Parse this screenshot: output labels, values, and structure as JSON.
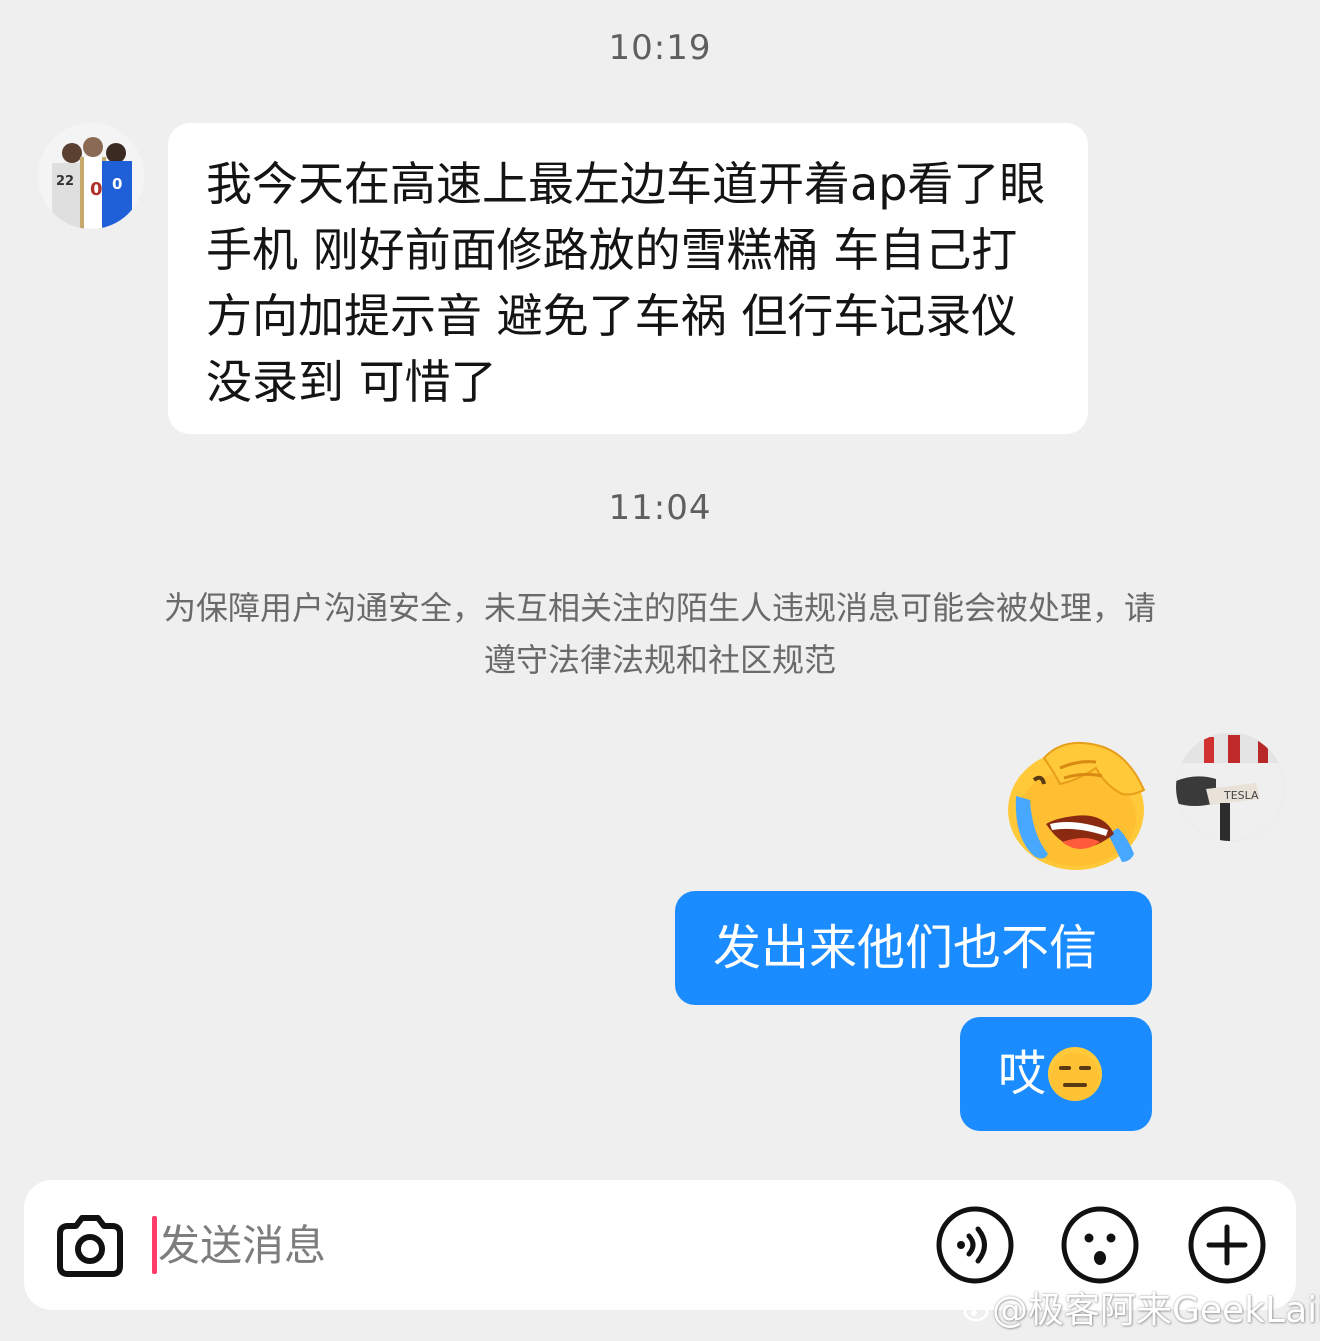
{
  "messages": {
    "timestamp_1": "10:19",
    "incoming_text": "我今天在高速上最左边车道开着ap看了眼手机 刚好前面修路放的雪糕桶  车自己打方向加提示音 避免了车祸   但行车记录仪没录到 可惜了",
    "timestamp_2": "11:04",
    "notice": "为保障用户沟通安全，未互相关注的陌生人违规消息可能会被处理，请遵守法律法规和社区规范",
    "outgoing_1": "发出来他们也不信",
    "outgoing_2": "哎"
  },
  "icons": {
    "sticker": "facepalm-crying-emoji",
    "inline_emoji": "expressionless-face-emoji",
    "camera": "camera-icon",
    "voice": "voice-icon",
    "emoji": "emoji-icon",
    "plus": "plus-icon"
  },
  "input": {
    "placeholder": "发送消息"
  },
  "watermark": {
    "text": "@极客阿来GeekLaii"
  },
  "colors": {
    "background": "#efefef",
    "incoming_bubble": "#ffffff",
    "outgoing_bubble": "#1a8cff",
    "caret": "#ff3b6b"
  }
}
